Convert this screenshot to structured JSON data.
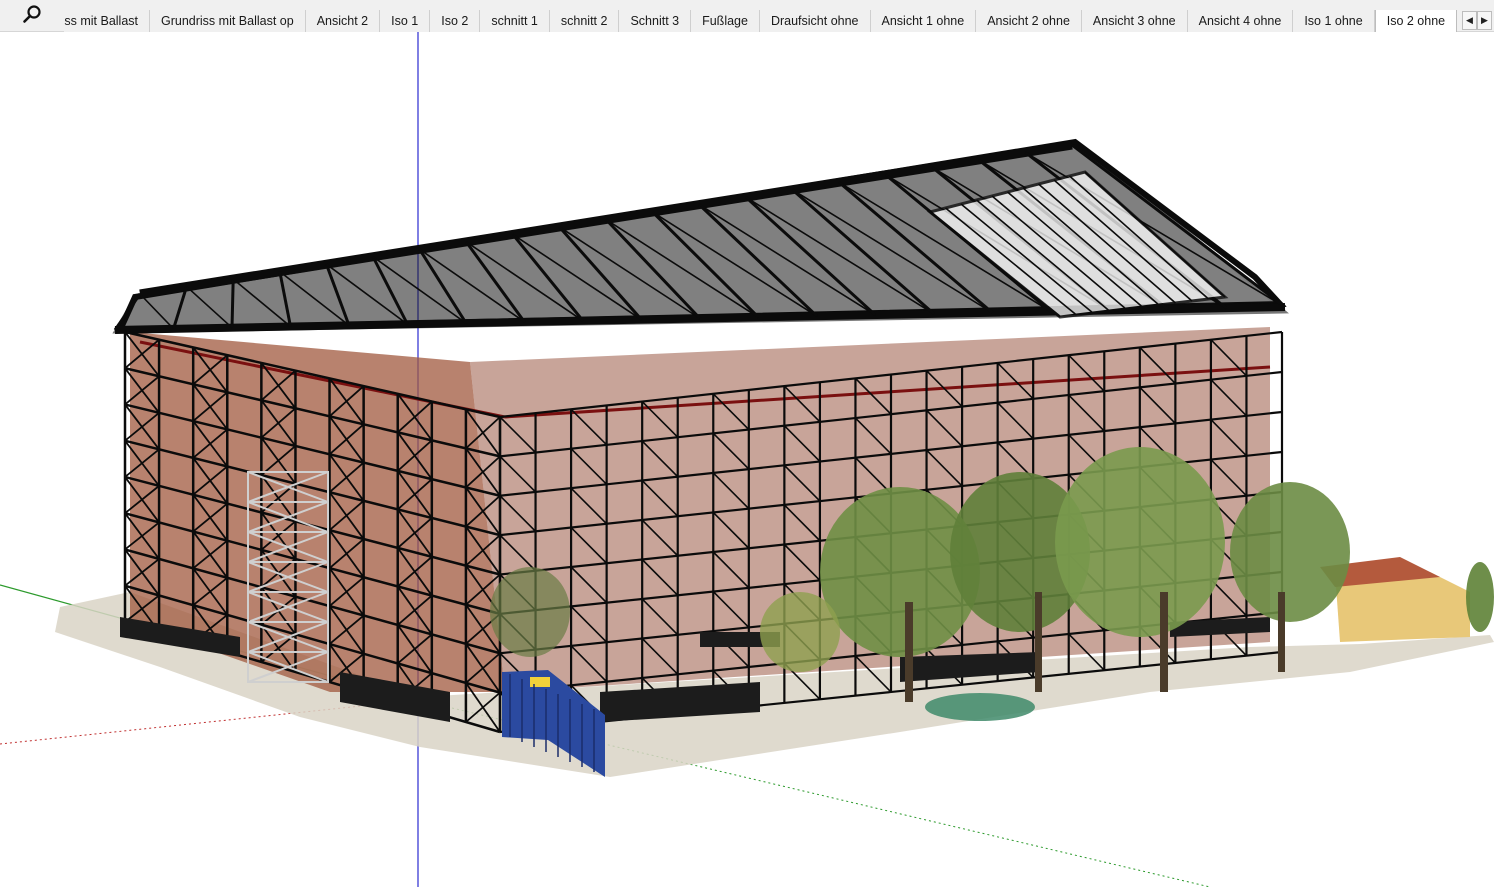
{
  "toolbar": {
    "search_icon": "magnifier-icon",
    "tabs": [
      {
        "label": "Grundriss mit Ballast",
        "active": false
      },
      {
        "label": "Grundriss mit Ballast op",
        "active": false
      },
      {
        "label": "Ansicht 2",
        "active": false
      },
      {
        "label": "Iso 1",
        "active": false
      },
      {
        "label": "Iso 2",
        "active": false
      },
      {
        "label": "schnitt 1",
        "active": false
      },
      {
        "label": "schnitt 2",
        "active": false
      },
      {
        "label": "Schnitt 3",
        "active": false
      },
      {
        "label": "Fußlage",
        "active": false
      },
      {
        "label": "Draufsicht ohne",
        "active": false
      },
      {
        "label": "Ansicht 1 ohne",
        "active": false
      },
      {
        "label": "Ansicht 2 ohne",
        "active": false
      },
      {
        "label": "Ansicht 3 ohne",
        "active": false
      },
      {
        "label": "Ansicht 4 ohne",
        "active": false
      },
      {
        "label": "Iso 1 ohne",
        "active": false
      },
      {
        "label": "Iso 2 ohne",
        "active": true
      }
    ],
    "scroll_left_icon": "triangle-left-icon",
    "scroll_right_icon": "triangle-right-icon"
  },
  "model": {
    "axis_colors": {
      "blue": "#2b2bd0",
      "red": "#c03030",
      "green": "#2c9a2c"
    },
    "scaffold_color": "#0b0b0b",
    "brick_color": "#a0583e",
    "tree_color": "#5f7f3a",
    "fence_color": "#2b4aa0"
  }
}
